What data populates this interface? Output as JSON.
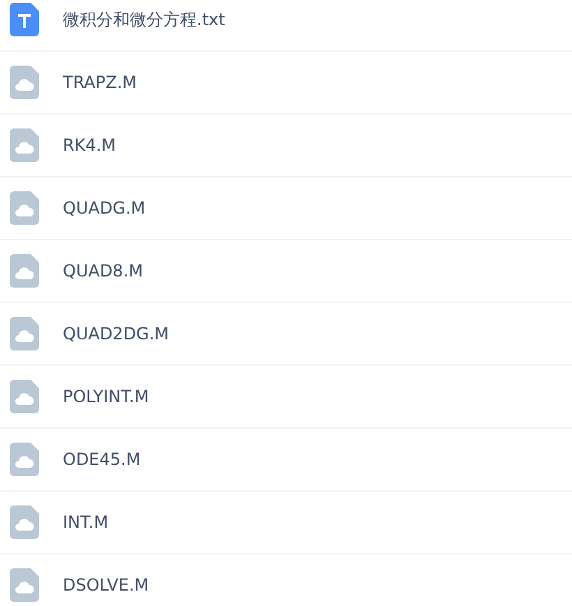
{
  "files": [
    {
      "name": "微积分和微分方程.txt",
      "kind": "text"
    },
    {
      "name": "TRAPZ.M",
      "kind": "unknown"
    },
    {
      "name": "RK4.M",
      "kind": "unknown"
    },
    {
      "name": "QUADG.M",
      "kind": "unknown"
    },
    {
      "name": "QUAD8.M",
      "kind": "unknown"
    },
    {
      "name": "QUAD2DG.M",
      "kind": "unknown"
    },
    {
      "name": "POLYINT.M",
      "kind": "unknown"
    },
    {
      "name": "ODE45.M",
      "kind": "unknown"
    },
    {
      "name": "INT.M",
      "kind": "unknown"
    },
    {
      "name": "DSOLVE.M",
      "kind": "unknown"
    }
  ]
}
